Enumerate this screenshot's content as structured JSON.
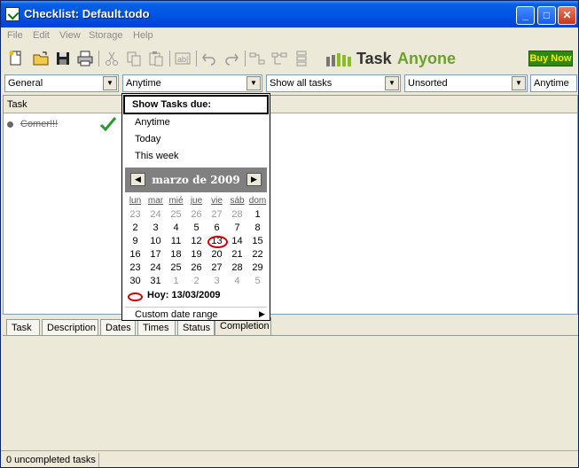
{
  "window": {
    "title": "Checklist: Default.todo"
  },
  "menu": [
    "File",
    "Edit",
    "View",
    "Storage",
    "Help"
  ],
  "brand": {
    "task": "Task",
    "anyone": "Anyone",
    "buy_label": "Buy Now"
  },
  "filters": {
    "category": "General",
    "due": "Anytime",
    "show": "Show all tasks",
    "sort": "Unsorted",
    "extra": "Anytime"
  },
  "list": {
    "column_task": "Task",
    "tasks": [
      {
        "label": "Comer!!!",
        "completed": true
      }
    ]
  },
  "dropdown": {
    "title": "Show Tasks due:",
    "options": [
      "Anytime",
      "Today",
      "This week"
    ],
    "calendar": {
      "month_label": "marzo de 2009",
      "prev": "◀",
      "next": "▶",
      "weekdays": [
        "lun",
        "mar",
        "mié",
        "jue",
        "vie",
        "sáb",
        "dom"
      ],
      "weeks": [
        [
          "23",
          "24",
          "25",
          "26",
          "27",
          "28",
          "1"
        ],
        [
          "2",
          "3",
          "4",
          "5",
          "6",
          "7",
          "8"
        ],
        [
          "9",
          "10",
          "11",
          "12",
          "13",
          "14",
          "15"
        ],
        [
          "16",
          "17",
          "18",
          "19",
          "20",
          "21",
          "22"
        ],
        [
          "23",
          "24",
          "25",
          "26",
          "27",
          "28",
          "29"
        ],
        [
          "30",
          "31",
          "1",
          "2",
          "3",
          "4",
          "5"
        ]
      ],
      "muted": [
        [
          0,
          0
        ],
        [
          0,
          1
        ],
        [
          0,
          2
        ],
        [
          0,
          3
        ],
        [
          0,
          4
        ],
        [
          0,
          5
        ],
        [
          5,
          2
        ],
        [
          5,
          3
        ],
        [
          5,
          4
        ],
        [
          5,
          5
        ],
        [
          5,
          6
        ]
      ],
      "today_label": "Hoy: 13/03/2009"
    },
    "custom_range": "Custom date range",
    "custom_arrow": "▶"
  },
  "tabs": [
    "Task",
    "Description",
    "Dates",
    "Times",
    "Status",
    "Completion"
  ],
  "status": {
    "text": "0 uncompleted tasks"
  },
  "colors": {
    "titlebar": "#0055E5",
    "accent_green": "#2b8a0f",
    "buy_text": "#ffe800",
    "today_mark": "#c00000"
  }
}
